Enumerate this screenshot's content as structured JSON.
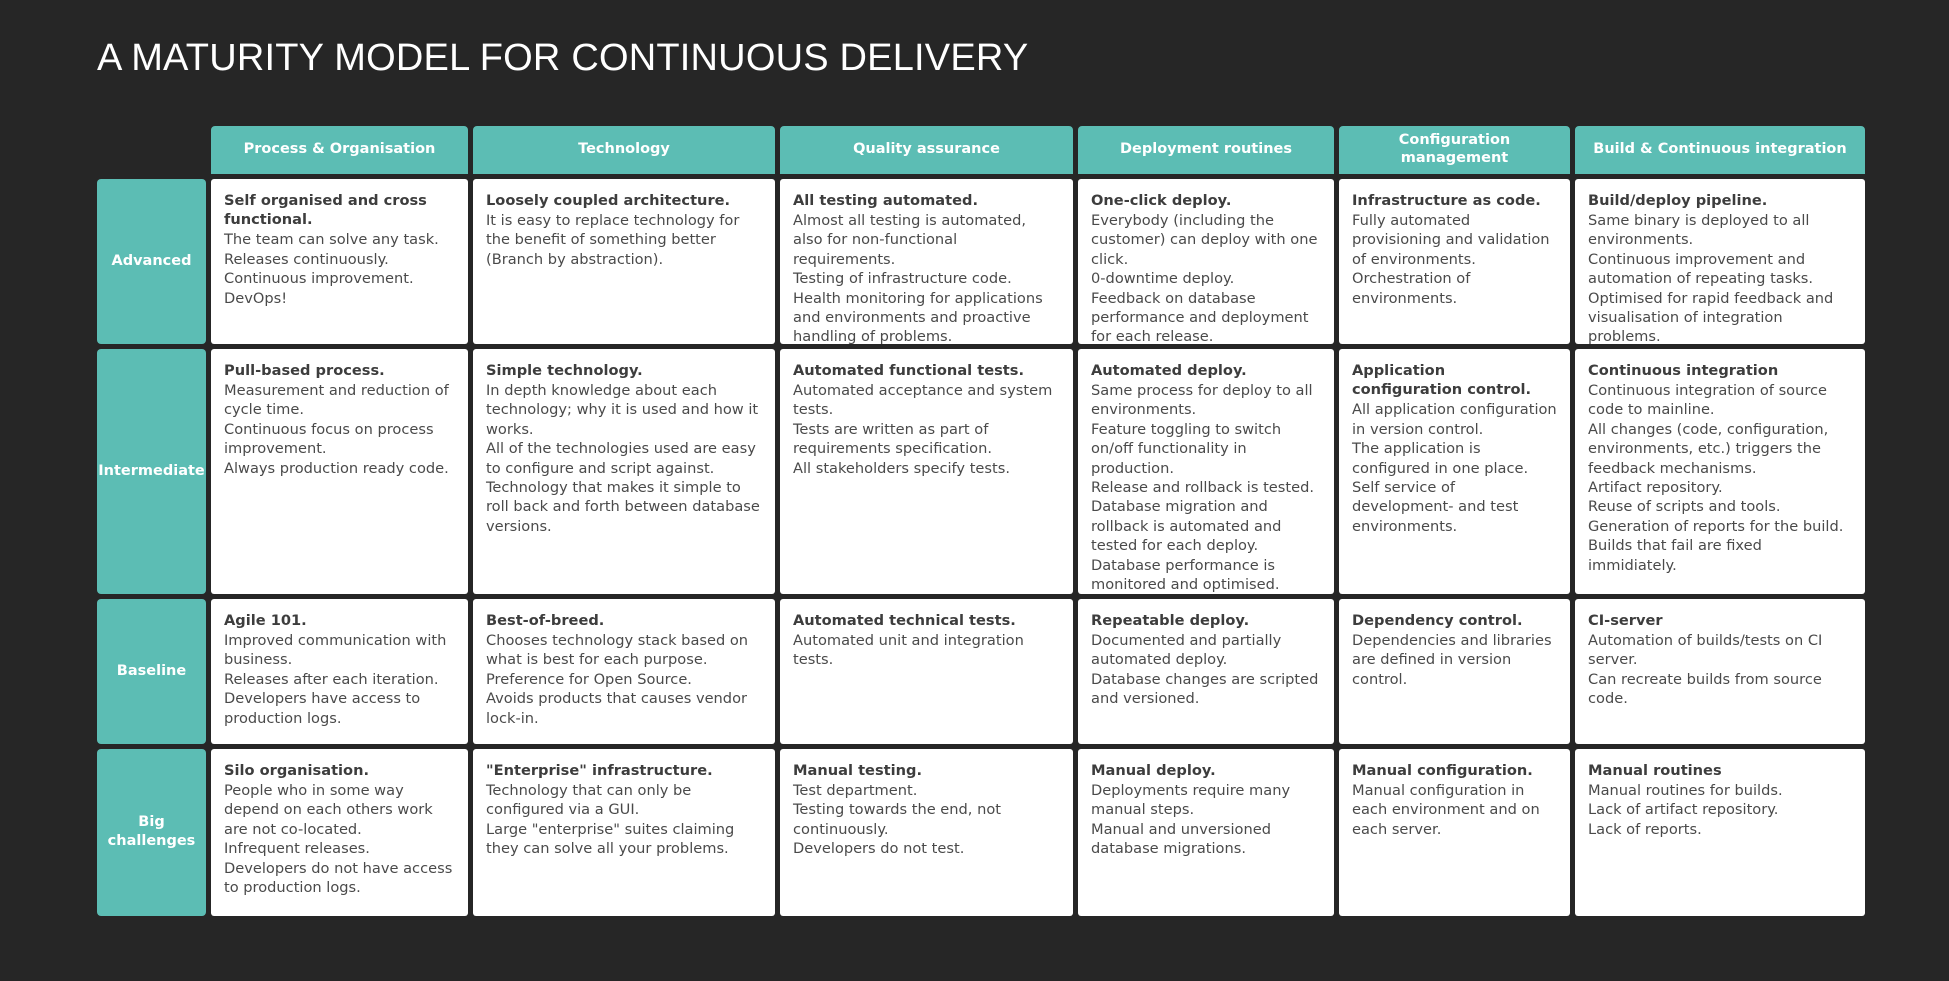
{
  "title": "A MATURITY MODEL FOR CONTINUOUS DELIVERY",
  "colors": {
    "background": "#262626",
    "accent_teal": "#5cbdb4",
    "cell_background": "#ffffff",
    "title_text": "#ffffff",
    "body_text": "#4a4a4a"
  },
  "columns": [
    {
      "label": "Process & Organisation"
    },
    {
      "label": "Technology"
    },
    {
      "label": "Quality assurance"
    },
    {
      "label": "Deployment routines"
    },
    {
      "label": "Configuration management"
    },
    {
      "label": "Build & Continuous integration"
    }
  ],
  "rows": [
    {
      "label": "Advanced",
      "cells": [
        {
          "title": "Self organised and cross functional.",
          "lines": [
            "The team can solve any task.",
            "Releases continuously.",
            "Continuous improvement.",
            "DevOps!"
          ]
        },
        {
          "title": "Loosely coupled architecture.",
          "lines": [
            "It is easy to replace technology for the benefit of something better (Branch by abstraction)."
          ]
        },
        {
          "title": "All testing automated.",
          "lines": [
            "Almost all testing is automated, also for non-functional requirements.",
            "Testing of infrastructure code.",
            "Health monitoring for applications and environments and proactive handling of problems."
          ]
        },
        {
          "title": "One-click deploy.",
          "lines": [
            "Everybody (including the customer) can deploy with one click.",
            "0-downtime deploy.",
            "Feedback on database performance and deployment for each release."
          ]
        },
        {
          "title": "Infrastructure as code.",
          "lines": [
            "Fully automated provisioning and validation of environments.",
            "Orchestration of environments."
          ]
        },
        {
          "title": "Build/deploy pipeline.",
          "lines": [
            "Same binary is deployed to all environments.",
            "Continuous improvement and automation of repeating tasks.",
            "Optimised for rapid feedback and visualisation of integration problems."
          ]
        }
      ]
    },
    {
      "label": "Intermediate",
      "cells": [
        {
          "title": "Pull-based process.",
          "lines": [
            "Measurement and reduction of cycle time.",
            "Continuous focus on process improvement.",
            "Always production ready code."
          ]
        },
        {
          "title": "Simple technology.",
          "lines": [
            "In depth knowledge about each technology; why it is used and how it works.",
            "All of the technologies used are easy to configure and script against.",
            "Technology that makes it simple to roll back and forth between database versions."
          ]
        },
        {
          "title": "Automated functional tests.",
          "lines": [
            "Automated acceptance and system tests.",
            "Tests are written as part of requirements specification.",
            "All stakeholders specify tests."
          ]
        },
        {
          "title": "Automated deploy.",
          "lines": [
            "Same process for deploy to all environments.",
            "Feature toggling to switch on/off functionality in production.",
            "Release and rollback is tested.",
            "Database migration and rollback is automated and tested for each deploy.",
            "Database performance is monitored and optimised."
          ]
        },
        {
          "title": "Application configuration control.",
          "lines": [
            "All application configuration in version control.",
            "The application is configured in one place.",
            "Self service of development- and test environments."
          ]
        },
        {
          "title": "Continuous integration",
          "lines": [
            "Continuous integration of source code to mainline.",
            "All changes (code, configuration, environments, etc.) triggers the feedback mechanisms.",
            "Artifact repository.",
            "Reuse of scripts and tools.",
            "Generation of reports for the build.",
            "Builds that fail are fixed immidiately."
          ]
        }
      ]
    },
    {
      "label": "Baseline",
      "cells": [
        {
          "title": "Agile 101.",
          "lines": [
            "Improved communication with business.",
            "Releases after each iteration.",
            "Developers have access to production logs."
          ]
        },
        {
          "title": "Best-of-breed.",
          "lines": [
            "Chooses technology stack based on what is best for each purpose.",
            "Preference for Open Source.",
            "Avoids products that causes vendor lock-in."
          ]
        },
        {
          "title": "Automated technical tests.",
          "lines": [
            "Automated unit and integration tests."
          ]
        },
        {
          "title": "Repeatable deploy.",
          "lines": [
            "Documented and partially automated deploy.",
            "Database changes are scripted and versioned."
          ]
        },
        {
          "title": "Dependency control.",
          "lines": [
            "Dependencies and libraries are defined in version control."
          ]
        },
        {
          "title": "CI-server",
          "lines": [
            "Automation of builds/tests on CI server.",
            "Can recreate builds from source code."
          ]
        }
      ]
    },
    {
      "label": "Big challenges",
      "cells": [
        {
          "title": "Silo organisation.",
          "lines": [
            "People who in some way depend on each others work are not co-located.",
            "Infrequent releases.",
            "Developers do not have access to production logs."
          ]
        },
        {
          "title": "\"Enterprise\" infrastructure.",
          "lines": [
            "Technology that can only be configured via a GUI.",
            "Large \"enterprise\" suites claiming they can solve all your problems."
          ]
        },
        {
          "title": "Manual testing.",
          "lines": [
            "Test department.",
            "Testing towards the end, not continuously.",
            "Developers do not test."
          ]
        },
        {
          "title": "Manual deploy.",
          "lines": [
            "Deployments require many manual steps.",
            "Manual and unversioned database migrations."
          ]
        },
        {
          "title": "Manual configuration.",
          "lines": [
            "Manual configuration in each environment and on each server."
          ]
        },
        {
          "title": "Manual routines",
          "lines": [
            "Manual routines for builds.",
            "Lack of artifact repository.",
            "Lack of reports."
          ]
        }
      ]
    }
  ]
}
